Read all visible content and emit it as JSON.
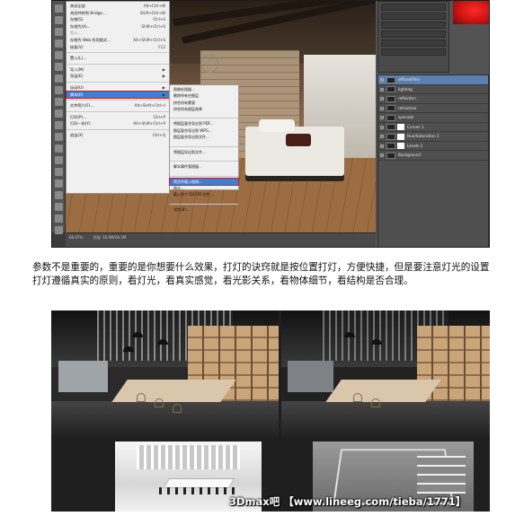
{
  "photoshop": {
    "menu": [
      {
        "label": "关闭全部",
        "shortcut": "Alt+Ctrl+W"
      },
      {
        "label": "关闭并转到 Bridge...",
        "shortcut": "Shift+Ctrl+W"
      },
      {
        "label": "存储(S)",
        "shortcut": "Ctrl+S"
      },
      {
        "label": "存储为(A)...",
        "shortcut": "Shift+Ctrl+S"
      },
      {
        "label": "签入...",
        "shortcut": "",
        "dim": true
      },
      {
        "label": "存储为 Web 所用格式...",
        "shortcut": "Alt+Shift+Ctrl+S"
      },
      {
        "label": "恢复(V)",
        "shortcut": "F12"
      },
      {
        "label": "",
        "sep": true
      },
      {
        "label": "置入(L)...",
        "shortcut": ""
      },
      {
        "label": "",
        "sep": true
      },
      {
        "label": "导入(M)",
        "shortcut": "▶"
      },
      {
        "label": "导出(E)",
        "shortcut": "▶"
      },
      {
        "label": "",
        "sep": true
      },
      {
        "label": "自动(U)",
        "shortcut": "▶"
      },
      {
        "label": "脚本(R)",
        "shortcut": "▶",
        "highlight": true
      },
      {
        "label": "",
        "sep": true
      },
      {
        "label": "文件简介(F)...",
        "shortcut": "Alt+Shift+Ctrl+I"
      },
      {
        "label": "",
        "sep": true
      },
      {
        "label": "打印(P)...",
        "shortcut": "Ctrl+P"
      },
      {
        "label": "打印一份(Y)",
        "shortcut": "Alt+Shift+Ctrl+P"
      },
      {
        "label": "",
        "sep": true
      },
      {
        "label": "退出(X)",
        "shortcut": "Ctrl+Q"
      }
    ],
    "submenu": [
      {
        "label": "图像处理器..."
      },
      {
        "label": "删除所有空图层"
      },
      {
        "label": "拼合所有蒙版"
      },
      {
        "label": "拼合所有图层效果"
      },
      {
        "label": "",
        "sep": true
      },
      {
        "label": "将图层复合导出到 PDF..."
      },
      {
        "label": "图层复合导出到 WPG..."
      },
      {
        "label": "图层复合导出到文件..."
      },
      {
        "label": "",
        "sep": true
      },
      {
        "label": "将图层导出到文件..."
      },
      {
        "label": "",
        "sep": true
      },
      {
        "label": "脚本事件管理器..."
      },
      {
        "label": "",
        "sep": true
      },
      {
        "label": "将文件载入堆栈...",
        "highlight": true
      },
      {
        "label": "统计..."
      },
      {
        "label": "载入多个 DICOM 文件..."
      },
      {
        "label": "",
        "sep": true
      },
      {
        "label": "浏览(B)..."
      }
    ],
    "status": [
      "66.67%",
      "文档: 16.0M/28.2M"
    ],
    "layers": [
      {
        "name": "diffuseFilter",
        "selected": true
      },
      {
        "name": "lighting"
      },
      {
        "name": "reflection"
      },
      {
        "name": "refraction"
      },
      {
        "name": "specular"
      },
      {
        "name": "Curves 1",
        "adjustment": true
      },
      {
        "name": "Hue/Saturation 1",
        "adjustment": true
      },
      {
        "name": "Levels 1",
        "adjustment": true
      },
      {
        "name": "Background"
      }
    ]
  },
  "paragraph": "参数不是重要的，重要的是你想要什么效果，打灯的诀窍就是按位置打灯，方便快捷，但是要注意灯光的设置打灯遵循真实的原则，看灯光，看真实感觉，看光影关系，看物体细节，看结构是否合理。",
  "renders": {
    "watermark_caption": "3Dmax吧 【www.lineeg.com/tieba/1771】"
  },
  "colors": {
    "highlight_blue": "#3d7fd6",
    "outline_red": "#d0191f"
  }
}
